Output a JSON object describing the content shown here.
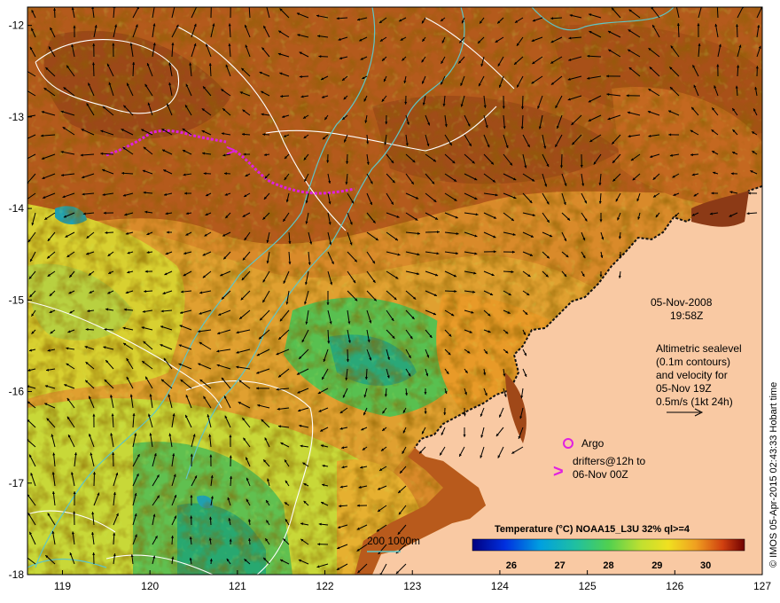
{
  "map": {
    "lon_ticks": [
      "119",
      "120",
      "121",
      "122",
      "123",
      "124",
      "125",
      "126",
      "127"
    ],
    "lat_ticks": [
      "-12",
      "-13",
      "-14",
      "-15",
      "-16",
      "-17",
      "-18"
    ],
    "lon_range": [
      118.6,
      127.0
    ],
    "lat_range": [
      -18.0,
      -11.8
    ]
  },
  "annotations": {
    "date": "05-Nov-2008",
    "time": "19:58Z",
    "altimetry_lines": [
      "Altimetric sealevel",
      "(0.1m contours)",
      "and velocity for",
      "05-Nov 19Z",
      "0.5m/s (1kt 24h)"
    ],
    "argo_label": "Argo",
    "drifter_line1": "drifters@12h to",
    "drifter_line2": "06-Nov 00Z",
    "depth_label": "200  1000m",
    "credit": "© IMOS 05-Apr-2015 02:43:33 Hobart time"
  },
  "colorbar": {
    "title": "Temperature (°C) NOAA15_L3U 32% ql>=4",
    "ticks": [
      "26",
      "27",
      "28",
      "29",
      "30"
    ],
    "range": [
      25.2,
      30.8
    ]
  },
  "colors": {
    "land": "#f9c9a3",
    "drifter": "#e020e0",
    "bathymetry": "#5fc6c6",
    "contour": "#ffffff"
  }
}
